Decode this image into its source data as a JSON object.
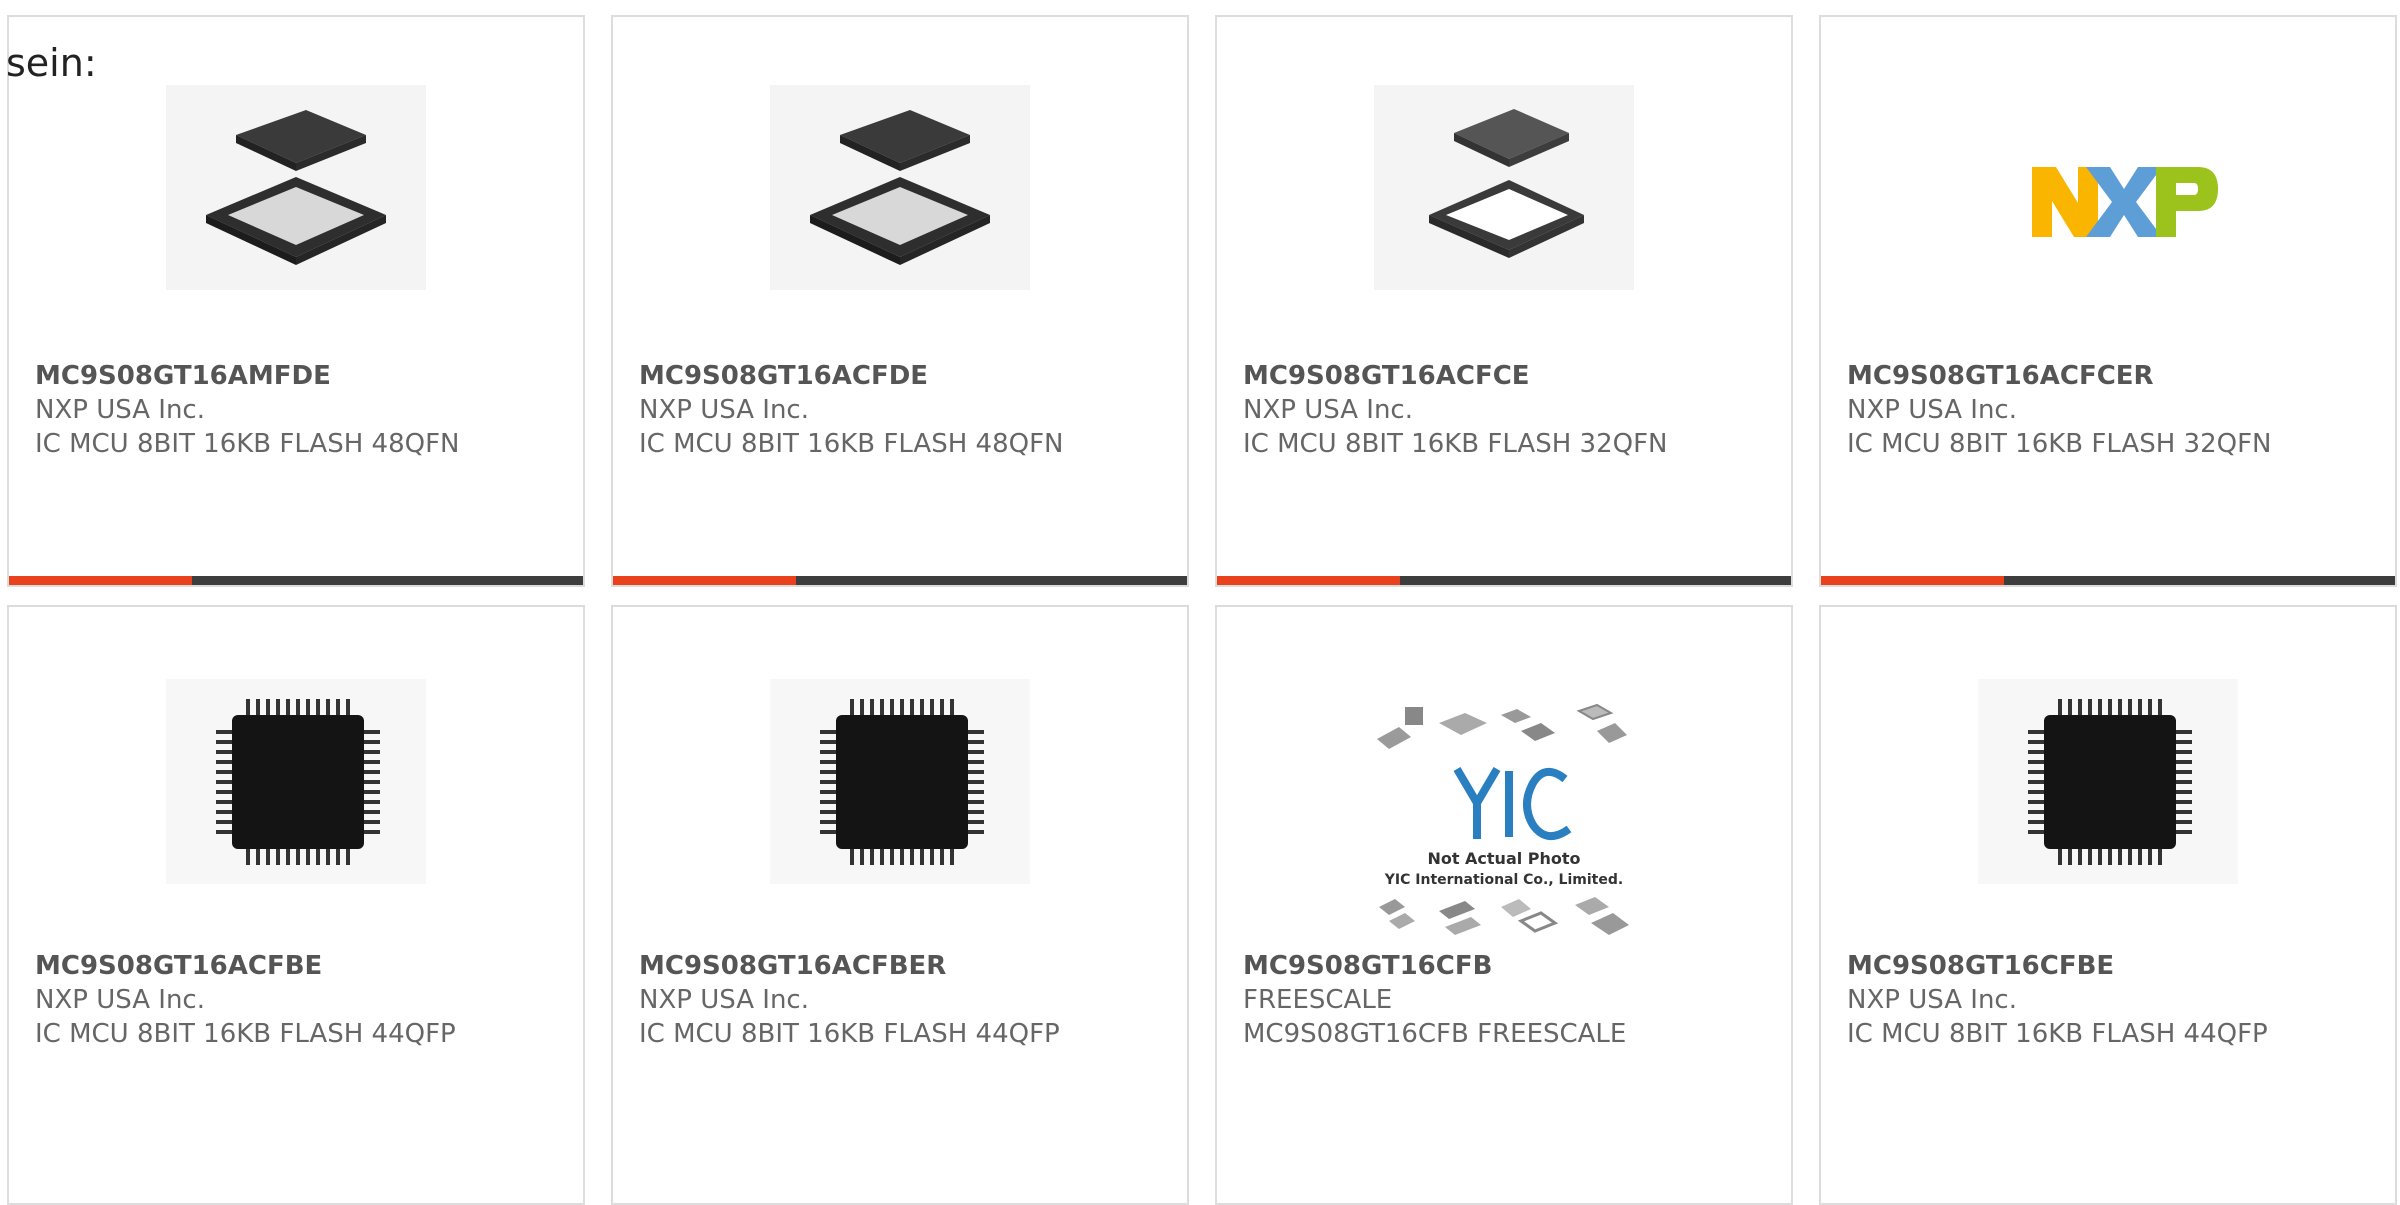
{
  "intro_text": "sein:",
  "colors": {
    "accent": "#e8411c",
    "bar": "#3d3d3d",
    "border": "#dcdcdc"
  },
  "products": [
    {
      "part": "MC9S08GT16AMFDE",
      "maker": "NXP USA Inc.",
      "desc": "IC MCU 8BIT 16KB FLASH 48QFN",
      "image": "qfn48-chip-icon"
    },
    {
      "part": "MC9S08GT16ACFDE",
      "maker": "NXP USA Inc.",
      "desc": "IC MCU 8BIT 16KB FLASH 48QFN",
      "image": "qfn48-chip-icon"
    },
    {
      "part": "MC9S08GT16ACFCE",
      "maker": "NXP USA Inc.",
      "desc": "IC MCU 8BIT 16KB FLASH 32QFN",
      "image": "qfn32-chip-icon"
    },
    {
      "part": "MC9S08GT16ACFCER",
      "maker": "NXP USA Inc.",
      "desc": "IC MCU 8BIT 16KB FLASH 32QFN",
      "image": "nxp-logo"
    },
    {
      "part": "MC9S08GT16ACFBE",
      "maker": "NXP USA Inc.",
      "desc": "IC MCU 8BIT 16KB FLASH 44QFP",
      "image": "qfp44-chip-icon"
    },
    {
      "part": "MC9S08GT16ACFBER",
      "maker": "NXP USA Inc.",
      "desc": "IC MCU 8BIT 16KB FLASH 44QFP",
      "image": "qfp44-chip-icon"
    },
    {
      "part": "MC9S08GT16CFB",
      "maker": "FREESCALE",
      "desc": "MC9S08GT16CFB FREESCALE",
      "image": "yic-placeholder",
      "placeholder_line1": "Not Actual Photo",
      "placeholder_line2": "YIC International Co., Limited.",
      "placeholder_logo": "YIC"
    },
    {
      "part": "MC9S08GT16CFBE",
      "maker": "NXP USA Inc.",
      "desc": "IC MCU 8BIT 16KB FLASH 44QFP",
      "image": "qfp44-chip-icon"
    }
  ]
}
